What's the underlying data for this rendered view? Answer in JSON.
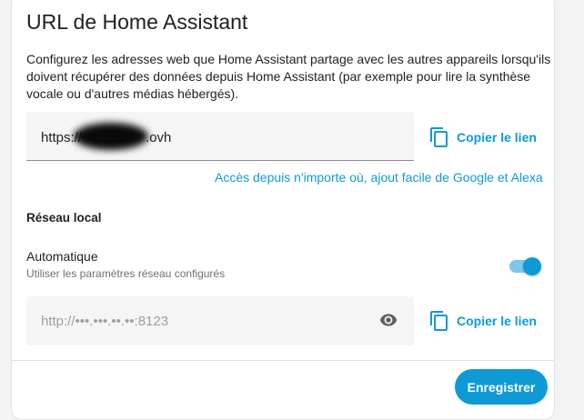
{
  "card": {
    "title": "URL de Home Assistant",
    "description": "Configurez les adresses web que Home Assistant partage avec les autres appareils lorsqu'ils doivent récupérer des données depuis Home Assistant (par exemple pour lire la synthèse vocale ou d'autres médias hébergés)."
  },
  "external": {
    "value_prefix": "https://",
    "value_suffix": ".ovh",
    "copy_label": "Copier le lien",
    "copy_icon": "content-copy-icon",
    "link_text": "Accès depuis n'importe où, ajout facile de Google et Alexa"
  },
  "local": {
    "section_title": "Réseau local",
    "automatic_label": "Automatique",
    "automatic_sub": "Utiliser les paramètres réseau configurés",
    "automatic_enabled": true,
    "value": "http://•••.•••.••.••:8123",
    "eye_icon": "eye-icon",
    "copy_label": "Copier le lien",
    "copy_icon": "content-copy-icon"
  },
  "footer": {
    "save_label": "Enregistrer"
  },
  "colors": {
    "accent": "#0f9ad6",
    "toggle_track": "#7cc8ea",
    "field_bg": "#f5f5f5"
  }
}
